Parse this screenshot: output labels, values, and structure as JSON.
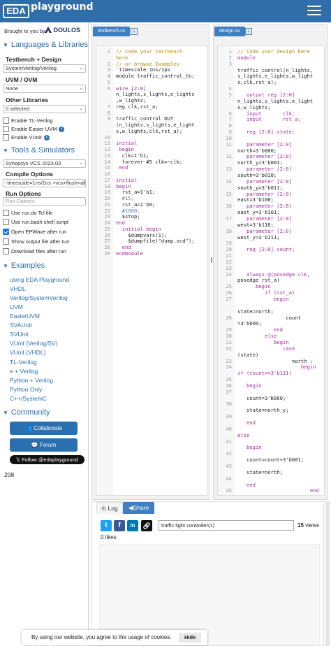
{
  "header": {
    "logo_box": "EDA",
    "logo_text": "playground"
  },
  "sidebar": {
    "brought_by": "Brought to you by",
    "doulos": "DOULOS",
    "lang_section": "Languages & Libraries",
    "tb_design_label": "Testbench + Design",
    "tb_design_value": "SystemVerilog/Verilog",
    "uvm_label": "UVM / OVM",
    "uvm_value": "None",
    "other_libs_label": "Other Libraries",
    "other_libs_value": "0 selected",
    "enable_tl": "Enable TL-Verilog",
    "enable_easier": "Enable Easier UVM",
    "enable_vunit": "Enable VUnit",
    "tools_section": "Tools & Simulators",
    "simulator_value": "Synopsys VCS 2023.03",
    "compile_label": "Compile Options",
    "compile_value": "-timescale=1ns/1ns +vcs+flush+all",
    "run_label": "Run Options",
    "run_placeholder": "Run Options",
    "use_rundo": "Use run.do Tcl file",
    "use_runbash": "Use run.bash shell script",
    "open_epwave": "Open EPWave after run",
    "show_output": "Show output file after run",
    "download": "Download files after run",
    "examples_section": "Examples",
    "examples": [
      "using EDA Playground",
      "VHDL",
      "Verilog/SystemVerilog",
      "UVM",
      "EasierUVM",
      "SVAUnit",
      "SVUnit",
      "VUnit (Verilog/SV)",
      "VUnit (VHDL)",
      "TL-Verilog",
      "e + Verilog",
      "Python + Verilog",
      "Python Only",
      "C++/SystemC"
    ],
    "community_section": "Community",
    "collaborate": "Collaborate",
    "forum": "Forum",
    "follow": "Follow @edaplayground",
    "count": "208"
  },
  "testbench": {
    "tab": "testbench.sv",
    "lines": [
      {
        "n": "1",
        "t": "// Code your testbench",
        "k": "cm"
      },
      {
        "n": "",
        "t": "here",
        "k": "cm"
      },
      {
        "n": "2",
        "t": "// or browse Examples",
        "k": "cm"
      },
      {
        "n": "3",
        "t": "`timescale 1ns/1ps",
        "k": "plain"
      },
      {
        "n": "4",
        "t": "module traffic_control_tb;",
        "k": "plain"
      },
      {
        "n": "5",
        "t": "",
        "k": "plain"
      },
      {
        "n": "6",
        "t": "wire [2:0]",
        "k": "kw"
      },
      {
        "n": "",
        "t": "n_lights,s_lights,e_lights",
        "k": "plain"
      },
      {
        "n": "",
        "t": ",w_lights;",
        "k": "plain"
      },
      {
        "n": "7",
        "t": "reg clk,rst_a;",
        "k": "plain"
      },
      {
        "n": "8",
        "t": "",
        "k": "plain"
      },
      {
        "n": "9",
        "t": "traffic_control DUT",
        "k": "plain"
      },
      {
        "n": "",
        "t": "(n_lights,s_lights,e_light",
        "k": "plain"
      },
      {
        "n": "",
        "t": "s,w_lights,clk,rst_a);",
        "k": "plain"
      },
      {
        "n": "10",
        "t": "",
        "k": "plain"
      },
      {
        "n": "11",
        "t": "initial",
        "k": "kw"
      },
      {
        "n": "12",
        "t": " begin",
        "k": "kw"
      },
      {
        "n": "13",
        "t": "  clk=1'b1;",
        "k": "plain"
      },
      {
        "n": "14",
        "t": "  forever #5 clk=~clk;",
        "k": "plain"
      },
      {
        "n": "15",
        "t": " end",
        "k": "kw"
      },
      {
        "n": "16",
        "t": "",
        "k": "plain"
      },
      {
        "n": "17",
        "t": "initial",
        "k": "kw"
      },
      {
        "n": "18",
        "t": "begin",
        "k": "kw"
      },
      {
        "n": "19",
        "t": "  rst_a=1'b1;",
        "k": "plain"
      },
      {
        "n": "20",
        "t": "  #15;",
        "k": "num"
      },
      {
        "n": "21",
        "t": "  rst_a=1'b0;",
        "k": "plain"
      },
      {
        "n": "22",
        "t": "  #1000;",
        "k": "num"
      },
      {
        "n": "23",
        "t": "  $stop;",
        "k": "plain"
      },
      {
        "n": "24",
        "t": "end",
        "k": "kw"
      },
      {
        "n": "25",
        "t": "  initial begin",
        "k": "kw"
      },
      {
        "n": "26",
        "t": "    $dumpvars(1);",
        "k": "plain"
      },
      {
        "n": "27",
        "t": "    $dumpfile(\"dump.vcd\");",
        "k": "plain"
      },
      {
        "n": "28",
        "t": "  end",
        "k": "kw"
      },
      {
        "n": "29",
        "t": "endmodule",
        "k": "kw"
      }
    ]
  },
  "design": {
    "tab": "design.sv",
    "lines": [
      {
        "n": "1",
        "t": "// Code your design here",
        "k": "cm"
      },
      {
        "n": "2",
        "t": "module",
        "k": "kw"
      },
      {
        "n": "3",
        "t": "",
        "k": "plain"
      },
      {
        "n": "",
        "t": "traffic_control(n_lights,",
        "k": "plain"
      },
      {
        "n": "",
        "t": "s_lights,e_lights,w_light",
        "k": "plain"
      },
      {
        "n": "",
        "t": "s,clk,rst_a);",
        "k": "plain"
      },
      {
        "n": "4",
        "t": "",
        "k": "plain"
      },
      {
        "n": "5",
        "t": "   output reg [2:0]",
        "k": "kw"
      },
      {
        "n": "",
        "t": "n_lights,s_lights,e_light",
        "k": "plain"
      },
      {
        "n": "",
        "t": "s,w_lights;",
        "k": "plain"
      },
      {
        "n": "6",
        "t": "   input       clk;",
        "k": "kw"
      },
      {
        "n": "7",
        "t": "   input       rst_a;",
        "k": "kw"
      },
      {
        "n": "8",
        "t": "",
        "k": "plain"
      },
      {
        "n": "9",
        "t": "   reg [2:0] state;",
        "k": "kw"
      },
      {
        "n": "10",
        "t": "",
        "k": "plain"
      },
      {
        "n": "11",
        "t": "   parameter [2:0]",
        "k": "kw"
      },
      {
        "n": "",
        "t": "north=3'b000;",
        "k": "plain"
      },
      {
        "n": "12",
        "t": "   parameter [2:0]",
        "k": "kw"
      },
      {
        "n": "",
        "t": "north_y=3'b001;",
        "k": "plain"
      },
      {
        "n": "13",
        "t": "   parameter [2:0]",
        "k": "kw"
      },
      {
        "n": "",
        "t": "south=3'b010;",
        "k": "plain"
      },
      {
        "n": "14",
        "t": "   parameter [2:0]",
        "k": "kw"
      },
      {
        "n": "",
        "t": "south_y=3'b011;",
        "k": "plain"
      },
      {
        "n": "15",
        "t": "   parameter [2:0]",
        "k": "kw"
      },
      {
        "n": "",
        "t": "east=3'b100;",
        "k": "plain"
      },
      {
        "n": "16",
        "t": "   parameter [2:0]",
        "k": "kw"
      },
      {
        "n": "",
        "t": "east_y=3'b101;",
        "k": "plain"
      },
      {
        "n": "17",
        "t": "   parameter [2:0]",
        "k": "kw"
      },
      {
        "n": "",
        "t": "west=3'b110;",
        "k": "plain"
      },
      {
        "n": "18",
        "t": "   parameter [2:0]",
        "k": "kw"
      },
      {
        "n": "",
        "t": "west_y=3'b111;",
        "k": "plain"
      },
      {
        "n": "19",
        "t": "",
        "k": "plain"
      },
      {
        "n": "20",
        "t": "   reg [2:0] count;",
        "k": "kw"
      },
      {
        "n": "21",
        "t": "",
        "k": "plain"
      },
      {
        "n": "22",
        "t": "",
        "k": "plain"
      },
      {
        "n": "23",
        "t": "",
        "k": "plain"
      },
      {
        "n": "24",
        "t": "   always @(posedge clk,",
        "k": "kw"
      },
      {
        "n": "",
        "t": "posedge rst_a)",
        "k": "plain"
      },
      {
        "n": "25",
        "t": "      begin",
        "k": "kw"
      },
      {
        "n": "26",
        "t": "         if (rst_a)",
        "k": "kw"
      },
      {
        "n": "27",
        "t": "            begin",
        "k": "kw"
      },
      {
        "n": "",
        "t": "",
        "k": "plain"
      },
      {
        "n": "",
        "t": "state=north;",
        "k": "plain"
      },
      {
        "n": "28",
        "t": "                count",
        "k": "plain"
      },
      {
        "n": "",
        "t": "=3'b000;",
        "k": "plain"
      },
      {
        "n": "29",
        "t": "            end",
        "k": "kw"
      },
      {
        "n": "30",
        "t": "         else",
        "k": "kw"
      },
      {
        "n": "31",
        "t": "            begin",
        "k": "kw"
      },
      {
        "n": "32",
        "t": "               case",
        "k": "kw"
      },
      {
        "n": "",
        "t": "(state)",
        "k": "plain"
      },
      {
        "n": "33",
        "t": "                  north :",
        "k": "plain"
      },
      {
        "n": "34",
        "t": "                     begin",
        "k": "kw"
      },
      {
        "n": "",
        "t": "if (count==3'b111)",
        "k": "kw"
      },
      {
        "n": "35",
        "t": "",
        "k": "plain"
      },
      {
        "n": "36",
        "t": "   begin",
        "k": "kw"
      },
      {
        "n": "37",
        "t": "",
        "k": "plain"
      },
      {
        "n": "",
        "t": "   count=3'b000;",
        "k": "plain"
      },
      {
        "n": "38",
        "t": "",
        "k": "plain"
      },
      {
        "n": "",
        "t": "   state=north_y;",
        "k": "plain"
      },
      {
        "n": "39",
        "t": "",
        "k": "plain"
      },
      {
        "n": "",
        "t": "   end",
        "k": "kw"
      },
      {
        "n": "40",
        "t": "",
        "k": "plain"
      },
      {
        "n": "",
        "t": "else",
        "k": "kw"
      },
      {
        "n": "41",
        "t": "",
        "k": "plain"
      },
      {
        "n": "",
        "t": "   begin",
        "k": "kw"
      },
      {
        "n": "42",
        "t": "",
        "k": "plain"
      },
      {
        "n": "",
        "t": "   count=count+3'b001;",
        "k": "plain"
      },
      {
        "n": "43",
        "t": "",
        "k": "plain"
      },
      {
        "n": "",
        "t": "   state=north;",
        "k": "plain"
      },
      {
        "n": "44",
        "t": "",
        "k": "plain"
      },
      {
        "n": "",
        "t": "   end",
        "k": "kw"
      },
      {
        "n": "45",
        "t": "                        end",
        "k": "kw"
      }
    ]
  },
  "bottom": {
    "log_tab": "Log",
    "share_tab": "Share",
    "share_value": "traffic light controller(1)",
    "views_count": "15",
    "views_label": "views",
    "likes_count": "0",
    "likes_label": "likes"
  },
  "cookie": {
    "text": "By using our website, you agree to the usage of cookies.",
    "hide": "Hide"
  }
}
